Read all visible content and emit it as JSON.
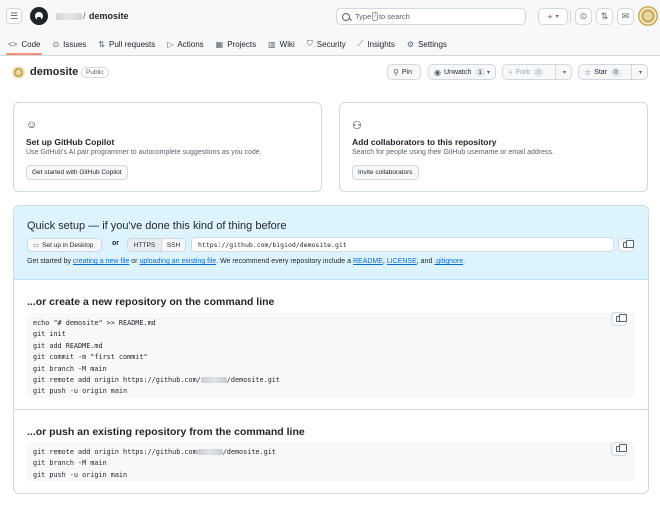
{
  "header": {
    "repo_name": "demosite",
    "slash": "/",
    "search_prefix": "Type",
    "search_key": "/",
    "search_suffix": "to search",
    "plus_icon": "+",
    "caret": "▾"
  },
  "nav": {
    "items": [
      {
        "label": "Code",
        "icon": "<>"
      },
      {
        "label": "Issues",
        "icon": "⊙"
      },
      {
        "label": "Pull requests",
        "icon": "⇅"
      },
      {
        "label": "Actions",
        "icon": "▷"
      },
      {
        "label": "Projects",
        "icon": "▦"
      },
      {
        "label": "Wiki",
        "icon": "▥"
      },
      {
        "label": "Security",
        "icon": "⛉"
      },
      {
        "label": "Insights",
        "icon": "⟋"
      },
      {
        "label": "Settings",
        "icon": "⚙"
      }
    ]
  },
  "repo": {
    "title": "demosite",
    "visibility": "Public",
    "pin_label": "Pin",
    "watch_label": "Unwatch",
    "watch_count": "1",
    "fork_label": "Fork",
    "fork_count": "0",
    "star_label": "Star",
    "star_count": "0"
  },
  "cards": {
    "copilot": {
      "title": "Set up GitHub Copilot",
      "desc": "Use GitHub's AI pair programmer to autocomplete suggestions as you code.",
      "button": "Get started with GitHub Copilot"
    },
    "collab": {
      "title": "Add collaborators to this repository",
      "desc": "Search for people using their GitHub username or email address.",
      "button": "Invite collaborators"
    }
  },
  "quick_setup": {
    "title": "Quick setup — if you've done this kind of thing before",
    "desktop_button": "Set up in Desktop",
    "or": "or",
    "https": "HTTPS",
    "ssh": "SSH",
    "url": "https://github.com/bigiod/demosite.git",
    "help": {
      "t1": "Get started by ",
      "l1": "creating a new file",
      "t2": " or ",
      "l2": "uploading an existing file",
      "t3": ". We recommend every repository include a ",
      "l3": "README",
      "t4": ", ",
      "l4": "LICENSE",
      "t5": ", and ",
      "l5": ".gitignore",
      "t6": "."
    }
  },
  "new_repo": {
    "title": "...or create a new repository on the command line",
    "lines": [
      "echo \"# demosite\" >> README.md",
      "git init",
      "git add README.md",
      "git commit -m \"first commit\"",
      "git branch -M main",
      "git remote add origin https://github.com/",
      "git push -u origin main"
    ],
    "remote_suffix": "/demosite.git"
  },
  "push_existing": {
    "title": "...or push an existing repository from the command line",
    "lines": [
      "git remote add origin https://github.com",
      "git branch -M main",
      "git push -u origin main"
    ],
    "remote_suffix": "/demosite.git"
  }
}
